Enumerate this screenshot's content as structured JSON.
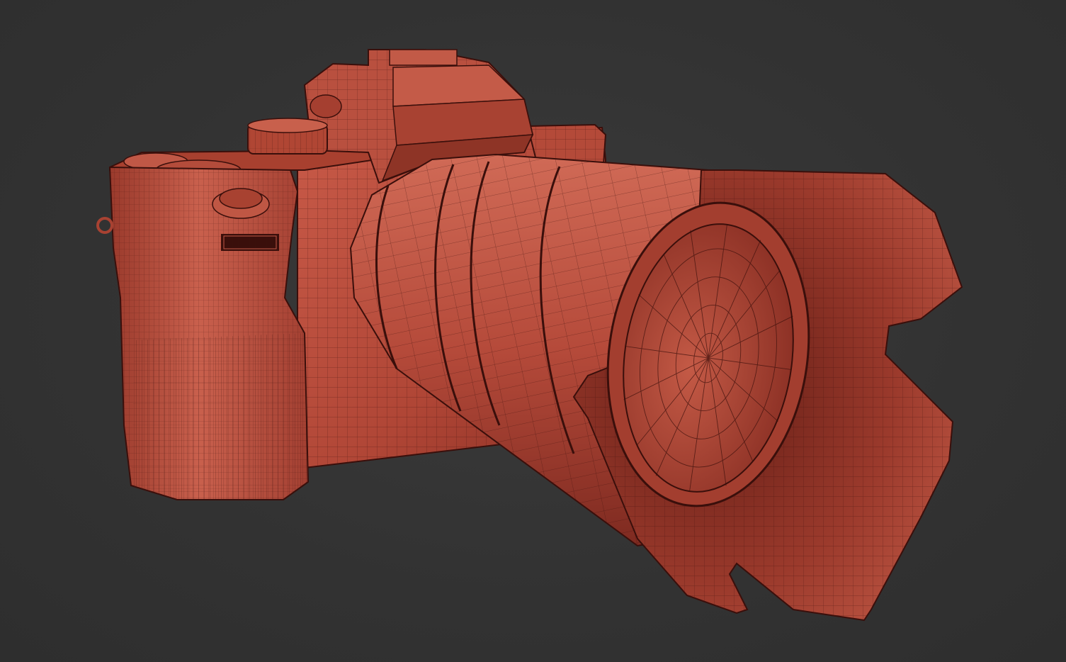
{
  "scene": {
    "background_color": "#333333",
    "mesh_color": "#b84a3c",
    "mesh_shadow_color": "#5a1a14",
    "wire_color": "#3a0f0b",
    "subject": "camera-wireframe-render"
  }
}
